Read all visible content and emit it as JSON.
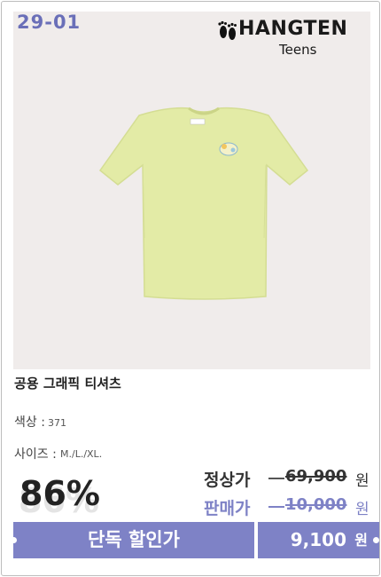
{
  "product": {
    "code": "29-01",
    "brand_logo": "HANGTEN",
    "brand_sub": "Teens",
    "name": "공용 그래픽 티셔츠",
    "color_label": "색상 :",
    "color_value": "371",
    "size_label": "사이즈 :",
    "size_value": "M./L./XL.",
    "discount": "86%",
    "regular_price_label": "정상가",
    "regular_price": "69,900",
    "sale_price_label": "판매가",
    "sale_price": "10,000",
    "currency": "원",
    "exclusive_label": "단독 할인가",
    "exclusive_price": "9,100",
    "exclusive_currency": "원"
  },
  "colors": {
    "accent": "#7e82c6",
    "sale_label": "#7e82c6",
    "shirt": "#e3eba6"
  },
  "icons": {
    "logo": "footprints-icon"
  }
}
